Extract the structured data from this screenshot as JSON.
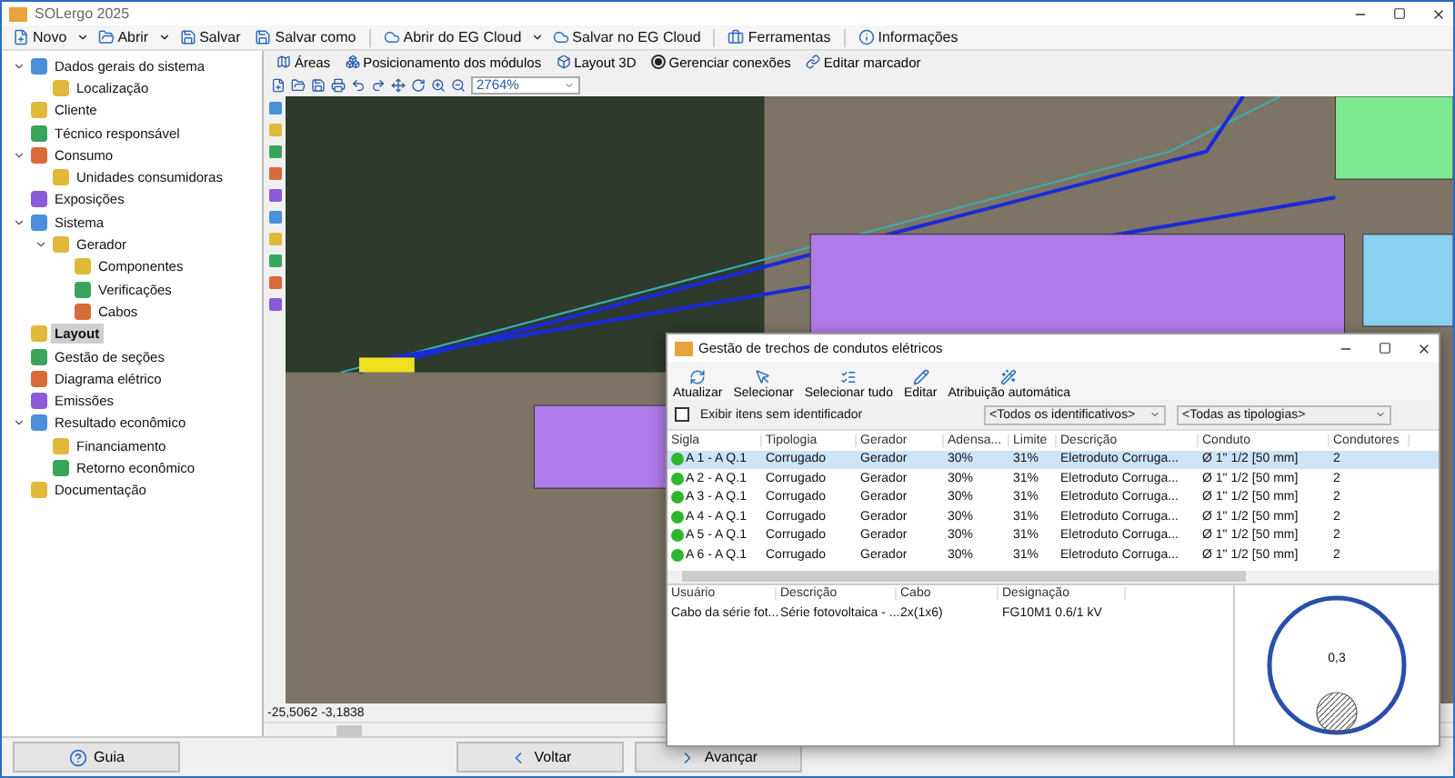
{
  "window": {
    "title": "SOLergo 2025"
  },
  "toolbar": [
    {
      "label": "Novo",
      "kind": "menu"
    },
    {
      "label": "Abrir",
      "kind": "menu"
    },
    {
      "label": "Salvar",
      "kind": "plain"
    },
    {
      "label": "Salvar como",
      "kind": "plain"
    },
    {
      "label": "Abrir do EG Cloud",
      "kind": "menu"
    },
    {
      "label": "Salvar no EG Cloud",
      "kind": "plain"
    },
    {
      "label": "Ferramentas",
      "kind": "plain"
    },
    {
      "label": "Informações",
      "kind": "plain"
    }
  ],
  "sidebar": {
    "items": [
      {
        "label": "Dados gerais do sistema",
        "selected": false,
        "expanded": true,
        "children": [
          {
            "label": "Localização",
            "selected": false
          }
        ]
      },
      {
        "label": "Cliente",
        "selected": false
      },
      {
        "label": "Técnico responsável",
        "selected": false
      },
      {
        "label": "Consumo",
        "selected": false,
        "expanded": true,
        "children": [
          {
            "label": "Unidades consumidoras",
            "selected": false
          }
        ]
      },
      {
        "label": "Exposições",
        "selected": false
      },
      {
        "label": "Sistema",
        "selected": false,
        "expanded": true,
        "children": [
          {
            "label": "Gerador",
            "selected": false,
            "expanded": true,
            "children": [
              {
                "label": "Componentes",
                "selected": false
              },
              {
                "label": "Verificações",
                "selected": false
              },
              {
                "label": "Cabos",
                "selected": false
              }
            ]
          }
        ]
      },
      {
        "label": "Layout",
        "selected": true
      },
      {
        "label": "Gestão de seções",
        "selected": false
      },
      {
        "label": "Diagrama elétrico",
        "selected": false
      },
      {
        "label": "Emissões",
        "selected": false
      },
      {
        "label": "Resultado econômico",
        "selected": false,
        "expanded": true,
        "children": [
          {
            "label": "Financiamento",
            "selected": false
          },
          {
            "label": "Retorno econômico",
            "selected": false
          }
        ]
      },
      {
        "label": "Documentação",
        "selected": false
      }
    ]
  },
  "canvas_tabs": [
    {
      "label": "Áreas",
      "kind": "button"
    },
    {
      "label": "Posicionamento dos módulos",
      "kind": "button"
    },
    {
      "label": "Layout 3D",
      "kind": "button"
    },
    {
      "label": "Gerenciar conexões",
      "kind": "radio",
      "selected": true
    },
    {
      "label": "Editar marcador",
      "kind": "button"
    }
  ],
  "zoom": "2764%",
  "coordinates": "-25,5062 -3,1838",
  "dialog": {
    "title": "Gestão de trechos de condutos elétricos",
    "actions": [
      "Atualizar",
      "Selecionar",
      "Selecionar tudo",
      "Editar",
      "Atribuição automática"
    ],
    "show_unidentified": {
      "label": "Exibir itens sem identificador",
      "checked": false
    },
    "filters": [
      "<Todos os identificativos>",
      "<Todas as tipologias>"
    ],
    "columns": [
      "Sigla",
      "Tipologia",
      "Gerador",
      "Adensa...",
      "Limite",
      "Descrição",
      "Conduto",
      "Condutores"
    ],
    "rows": [
      {
        "cells": [
          "A 1 - A Q.1",
          "Corrugado",
          "Gerador",
          "30%",
          "31%",
          "Eletroduto Corruga...",
          "Ø 1\" 1/2 [50 mm]",
          "2"
        ],
        "selected": true,
        "color": "#2fb52f"
      },
      {
        "cells": [
          "A 2 - A Q.1",
          "Corrugado",
          "Gerador",
          "30%",
          "31%",
          "Eletroduto Corruga...",
          "Ø 1\" 1/2 [50 mm]",
          "2"
        ],
        "selected": false,
        "color": "#2fb52f"
      },
      {
        "cells": [
          "A 3 - A Q.1",
          "Corrugado",
          "Gerador",
          "30%",
          "31%",
          "Eletroduto Corruga...",
          "Ø 1\" 1/2 [50 mm]",
          "2"
        ],
        "selected": false,
        "color": "#2fb52f"
      },
      {
        "cells": [
          "A 4 - A Q.1",
          "Corrugado",
          "Gerador",
          "30%",
          "31%",
          "Eletroduto Corruga...",
          "Ø 1\" 1/2 [50 mm]",
          "2"
        ],
        "selected": false,
        "color": "#2fb52f"
      },
      {
        "cells": [
          "A 5 - A Q.1",
          "Corrugado",
          "Gerador",
          "30%",
          "31%",
          "Eletroduto Corruga...",
          "Ø 1\" 1/2 [50 mm]",
          "2"
        ],
        "selected": false,
        "color": "#2fb52f"
      },
      {
        "cells": [
          "A 6 - A Q.1",
          "Corrugado",
          "Gerador",
          "30%",
          "31%",
          "Eletroduto Corruga...",
          "Ø 1\" 1/2 [50 mm]",
          "2"
        ],
        "selected": false,
        "color": "#2fb52f"
      }
    ],
    "detail_columns": [
      "Usuário",
      "Descrição",
      "Cabo",
      "Designação"
    ],
    "detail_rows": [
      [
        "Cabo da série fot...",
        "Série fotovoltaica - ...",
        "2x(1x6)",
        "FG10M1 0.6/1 kV"
      ]
    ],
    "fill_ratio": "0,3"
  },
  "footer": {
    "help": "Guia",
    "back": "Voltar",
    "next": "Avançar"
  }
}
